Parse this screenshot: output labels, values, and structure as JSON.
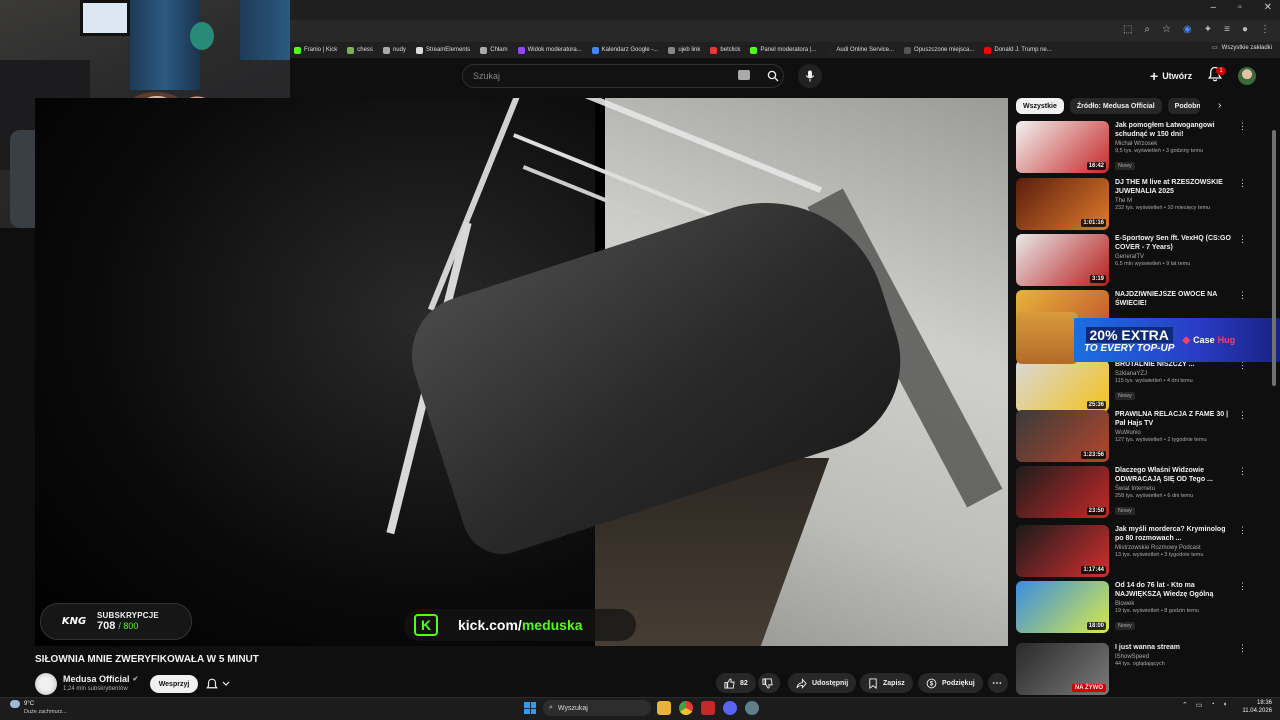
{
  "browser": {
    "bookmarks": [
      "Franio | Kick",
      "chess",
      "nudy",
      "StreamElements",
      "Chłam",
      "Widok moderatora...",
      "Kalendarz Google -...",
      "ujeb link",
      "betclick",
      "Panel moderatora |...",
      "Audi Online Service...",
      "Opuszczone miejsca...",
      "Donald J. Trump ne..."
    ],
    "all_bookmarks": "Wszystkie zakładki"
  },
  "header": {
    "search_placeholder": "Szukaj",
    "create_label": "Utwórz",
    "notif_count": "1"
  },
  "overlay": {
    "sub_title": "SUBSKRYPCJE",
    "sub_current": "708",
    "sub_goal": "/ 800",
    "sub_logo": "KNG",
    "kick_prefix": "kick.com/",
    "kick_channel": "meduska"
  },
  "video": {
    "title": "SIŁOWNIA MNIE ZWERYFIKOWAŁA W 5 MINUT",
    "channel": "Medusa Official",
    "subscribers": "1,24 mln subskrybentów",
    "support_label": "Wesprzyj",
    "likes": "82",
    "share_label": "Udostępnij",
    "save_label": "Zapisz",
    "thanks_label": "Podziękuj"
  },
  "sidebar": {
    "chips": [
      "Wszystkie",
      "Źródło: Medusa Official",
      "Podobne"
    ],
    "recommendations": [
      {
        "title": "Jak pomogłem Łatwogangowi schudnąć w 150 dni!",
        "channel": "Michał Wrzosek",
        "meta": "9,5 tys. wyświetleń • 3 godziny temu",
        "badge": "Nowy",
        "duration": "16:42",
        "colors": [
          "#f2f2f2",
          "#c62828"
        ]
      },
      {
        "title": "DJ THE M live at RZESZOWSKIE JUWENALIA 2025",
        "channel": "The M",
        "meta": "232 tys. wyświetleń • 10 miesięcy temu",
        "badge": "",
        "duration": "1:01:16",
        "colors": [
          "#5a1e0e",
          "#e07a2a"
        ]
      },
      {
        "title": "E-Sportowy Sen /ft. VexHQ (CS:GO COVER - 7 Years)",
        "channel": "GeneralTV",
        "meta": "6,5 mln wyświetleń • 9 lat temu",
        "badge": "",
        "duration": "3:19",
        "colors": [
          "#e9e9ea",
          "#b71c1c"
        ]
      },
      {
        "title": "NAJDZIWNIEJSZE OWOCE NA ŚWIECIE!",
        "channel": "",
        "meta": "",
        "badge": "",
        "duration": "",
        "colors": [
          "#e5b53a",
          "#c24d2c"
        ]
      },
      {
        "title": "BRUTALNIE NISZCZY ...",
        "channel": "SzklanaYZJ",
        "meta": "115 tys. wyświetleń • 4 dni temu",
        "badge": "Nowy",
        "duration": "25:36",
        "colors": [
          "#d9d9d9",
          "#f4c21b"
        ]
      },
      {
        "title": "PRAWILNA RELACJA Z FAME 30 | Pał Hajs TV",
        "channel": "WuWunio",
        "meta": "127 tys. wyświetleń • 2 tygodnie temu",
        "badge": "",
        "duration": "1:23:56",
        "colors": [
          "#3a3a3a",
          "#b5462c"
        ]
      },
      {
        "title": "Dlaczego Właśni Widzowie ODWRACAJĄ SIĘ OD Tego ...",
        "channel": "Świat Internetu",
        "meta": "258 tys. wyświetleń • 6 dni temu",
        "badge": "Nowy",
        "duration": "23:50",
        "colors": [
          "#1d1d1d",
          "#c62828"
        ]
      },
      {
        "title": "Jak myśli morderca? Kryminolog po 80 rozmowach ...",
        "channel": "Mistrzowskie Rozmowy Podcast",
        "meta": "13 tys. wyświetleń • 3 tygodnie temu",
        "badge": "",
        "duration": "1:17:44",
        "colors": [
          "#1a1a1a",
          "#d32f2f"
        ]
      },
      {
        "title": "Od 14 do 76 lat - Kto ma NAJWIĘKSZĄ Wiedzę Ogólną",
        "channel": "Blowek",
        "meta": "19 tys. wyświetleń • 8 godzin temu",
        "badge": "Nowy",
        "duration": "18:00",
        "colors": [
          "#3b8de0",
          "#d6e94a"
        ]
      },
      {
        "title": "I just wanna stream",
        "channel": "IShowSpeed",
        "meta": "44 tys. oglądających",
        "badge": "",
        "duration": "",
        "live": "NA ŻYWO",
        "colors": [
          "#2a2a2a",
          "#7a7a7a"
        ]
      }
    ],
    "ad": {
      "headline": "20% EXTRA",
      "sub": "TO EVERY TOP-UP",
      "brand_a": "Case",
      "brand_b": "Hug"
    }
  },
  "taskbar": {
    "weather_temp": "9°C",
    "weather_desc": "Duże zachmurz...",
    "search": "Wyszukaj",
    "time": "18:36",
    "date": "11.04.2026"
  }
}
